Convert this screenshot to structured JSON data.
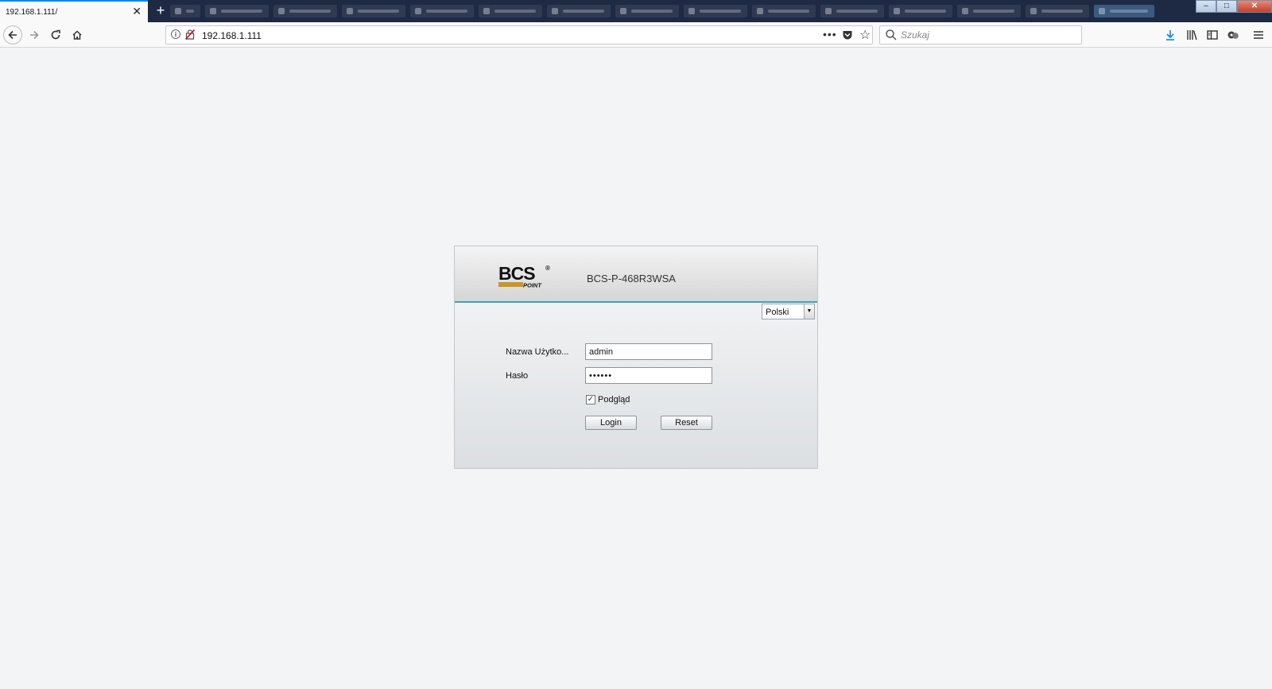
{
  "browser": {
    "active_tab_title": "192.168.1.111/",
    "url": "192.168.1.111",
    "search_placeholder": "Szukaj",
    "new_tab_label": "+",
    "close_tab_label": "✕"
  },
  "window_controls": {
    "minimize": "–",
    "maximize": "□",
    "close": "✕"
  },
  "login": {
    "model": "BCS-P-468R3WSA",
    "language": "Polski",
    "username_label": "Nazwa Użytko...",
    "username_value": "admin",
    "password_label": "Hasło",
    "password_value": "••••••",
    "preview_label": "Podgląd",
    "preview_checked": true,
    "login_button": "Login",
    "reset_button": "Reset"
  },
  "colors": {
    "accent_line": "#3aa6b5",
    "logo_gold": "#c8962a",
    "tabbar": "#1e2a44"
  },
  "icons": [
    "back-icon",
    "forward-icon",
    "reload-icon",
    "home-icon",
    "info-icon",
    "insecure-icon",
    "more-icon",
    "pocket-icon",
    "star-icon",
    "search-icon",
    "download-icon",
    "library-icon",
    "sidebar-icon",
    "extension-icon",
    "menu-icon"
  ]
}
